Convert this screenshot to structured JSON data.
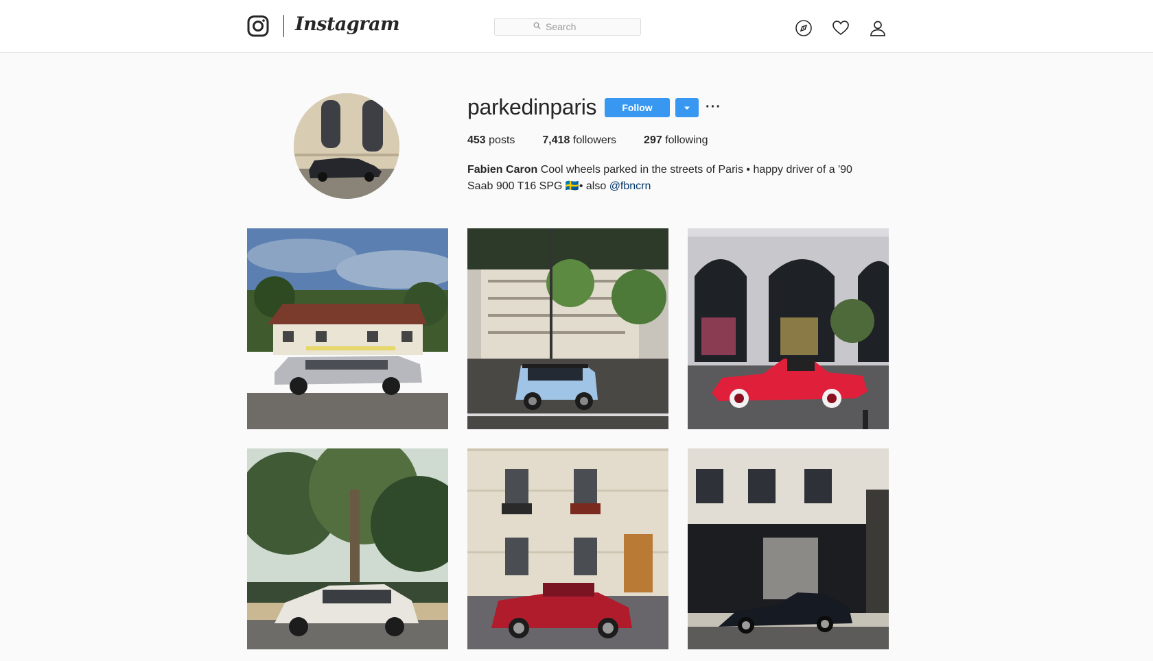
{
  "header": {
    "logo_text": "Instagram",
    "search": {
      "placeholder": "Search"
    },
    "icons": [
      "explore-icon",
      "heart-icon",
      "profile-icon"
    ]
  },
  "profile": {
    "username": "parkedinparis",
    "follow_label": "Follow",
    "more_label": "···",
    "stats": {
      "posts": {
        "count": "453",
        "label": "posts"
      },
      "followers": {
        "count": "7,418",
        "label": "followers"
      },
      "following": {
        "count": "297",
        "label": "following"
      }
    },
    "bio": {
      "name": "Fabien Caron",
      "text": "Cool wheels parked in the streets of Paris • happy driver of a '90 Saab 900 T16 SPG 🇸🇪• also",
      "mention": "@fbncrn"
    }
  },
  "colors": {
    "accent": "#3897f0",
    "background": "#fafafa",
    "text": "#262626",
    "mention": "#003569"
  },
  "posts": [
    {
      "id": "post-1",
      "car": "silver-estate"
    },
    {
      "id": "post-2",
      "car": "light-blue-mini"
    },
    {
      "id": "post-3",
      "car": "red-roadster"
    },
    {
      "id": "post-4",
      "car": "white-hatchback"
    },
    {
      "id": "post-5",
      "car": "red-cabriolet"
    },
    {
      "id": "post-6",
      "car": "black-coupe"
    }
  ]
}
